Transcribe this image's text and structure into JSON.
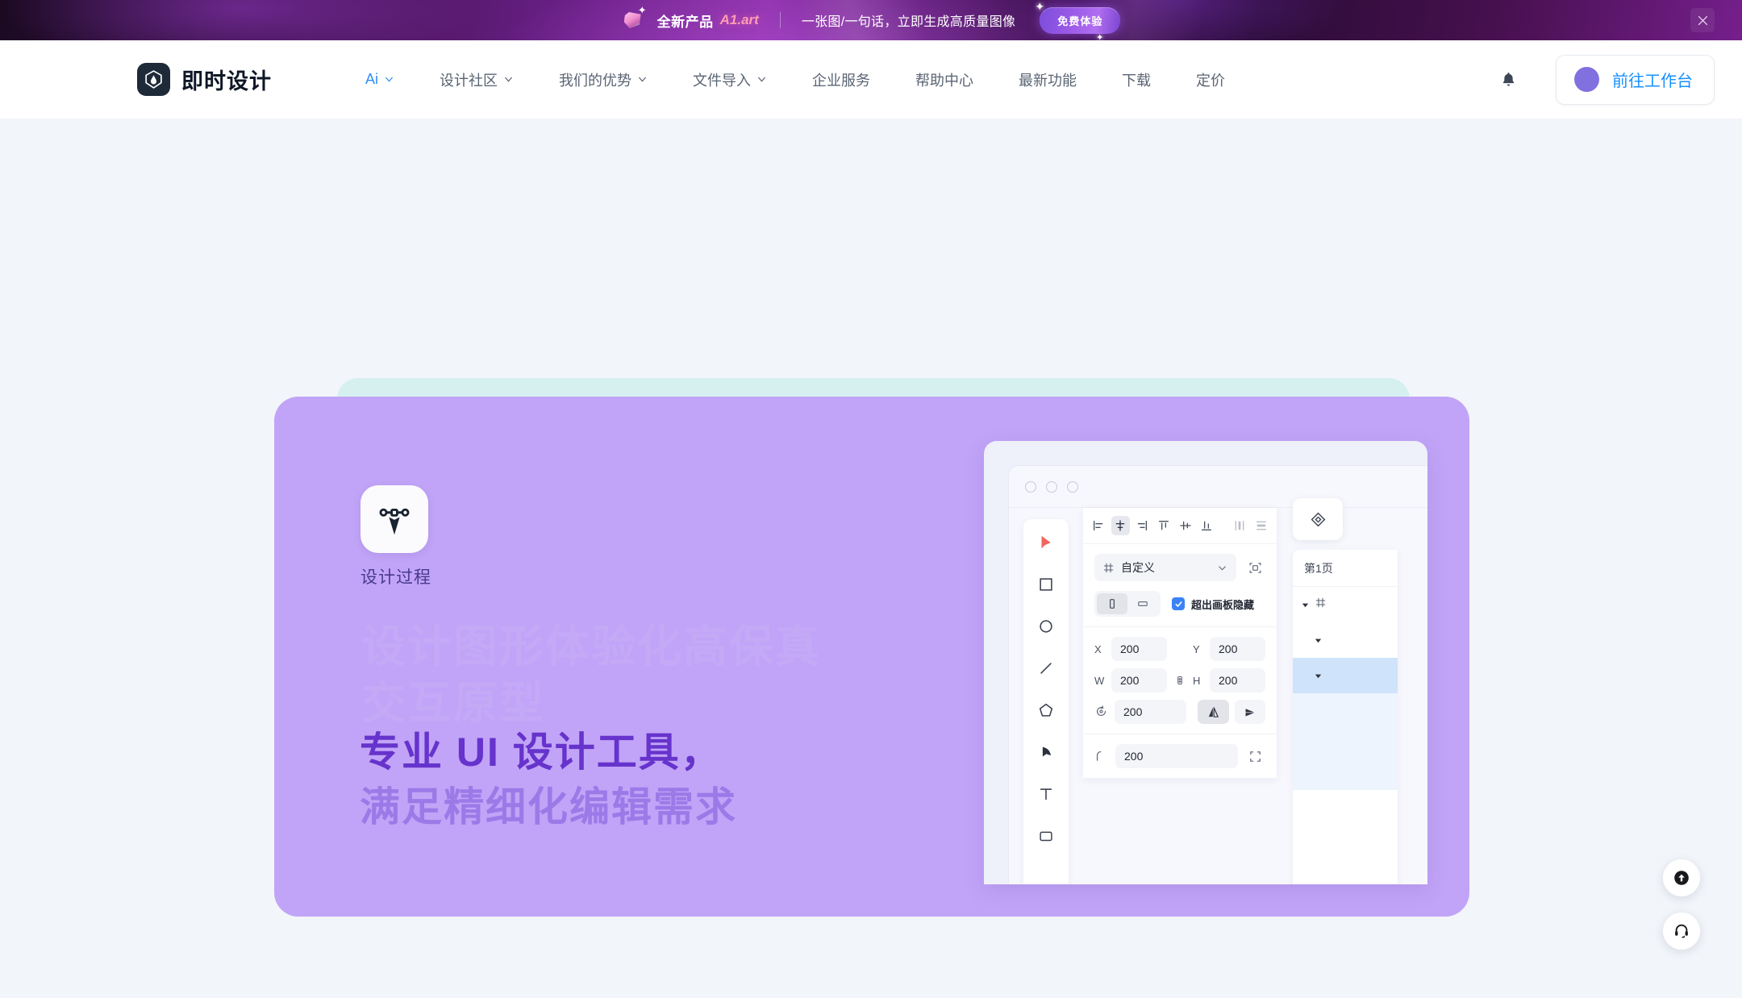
{
  "promo": {
    "gem_icon": "gem-icon",
    "title": "全新产品",
    "brand": "A1.art",
    "subtitle": "一张图/一句话，立即生成高质量图像",
    "cta": "免费体验",
    "close_icon": "close-icon"
  },
  "nav": {
    "logo_icon": "jishi-logo-icon",
    "logo_text": "即时设计",
    "items": [
      {
        "label": "Ai",
        "has_chevron": true,
        "active": true
      },
      {
        "label": "设计社区",
        "has_chevron": true,
        "active": false
      },
      {
        "label": "我们的优势",
        "has_chevron": true,
        "active": false
      },
      {
        "label": "文件导入",
        "has_chevron": true,
        "active": false
      },
      {
        "label": "企业服务",
        "has_chevron": false,
        "active": false
      },
      {
        "label": "帮助中心",
        "has_chevron": false,
        "active": false
      },
      {
        "label": "最新功能",
        "has_chevron": false,
        "active": false
      },
      {
        "label": "下载",
        "has_chevron": false,
        "active": false
      },
      {
        "label": "定价",
        "has_chevron": false,
        "active": false
      }
    ],
    "bell_icon": "bell-icon",
    "workspace_label": "前往工作台",
    "workspace_color": "#1890ff"
  },
  "hero": {
    "badge_icon": "vector-anchor-icon",
    "badge_label": "设计过程",
    "ghost_text": "设计图形体验化高保真交互原型",
    "headline_line1": "专业 UI 设计工具，",
    "headline_line2": "满足精细化编辑需求",
    "headline_color1": "#6633cc",
    "headline_color2": "#9b7ae8",
    "card_color": "#c1a4f7",
    "card_back_color": "#d6f0f0"
  },
  "mockup": {
    "window_dots": 3,
    "tools": [
      {
        "name": "cursor-tool",
        "icon": "cursor-icon"
      },
      {
        "name": "rectangle-tool",
        "icon": "square-icon"
      },
      {
        "name": "ellipse-tool",
        "icon": "circle-icon"
      },
      {
        "name": "line-tool",
        "icon": "line-icon"
      },
      {
        "name": "polygon-tool",
        "icon": "pentagon-icon"
      },
      {
        "name": "pen-tool",
        "icon": "pen-icon"
      },
      {
        "name": "text-tool",
        "icon": "text-T-icon"
      },
      {
        "name": "frame-tool",
        "icon": "frame-icon"
      }
    ],
    "align_buttons": [
      {
        "name": "align-left",
        "active": false
      },
      {
        "name": "align-horizontal-center",
        "active": true
      },
      {
        "name": "align-right",
        "active": false
      },
      {
        "name": "align-top",
        "active": false
      },
      {
        "name": "align-vertical-center",
        "active": false
      },
      {
        "name": "align-bottom",
        "active": false
      },
      {
        "name": "distribute-horizontal",
        "active": false
      },
      {
        "name": "distribute-vertical",
        "active": false
      }
    ],
    "preset_label": "自定义",
    "preset_icon": "frame-icon",
    "resize_icon": "fit-content-icon",
    "orientation": {
      "portrait_active": true,
      "landscape_active": false
    },
    "clip_checkbox": {
      "label": "超出画板隐藏",
      "checked": true,
      "color": "#3b82f6"
    },
    "fields": {
      "x_label": "X",
      "x_value": "200",
      "y_label": "Y",
      "y_value": "200",
      "w_label": "W",
      "w_value": "200",
      "h_label": "H",
      "h_value": "200",
      "rotation_value": "200",
      "radius_value": "200"
    },
    "flip_horizontal": {
      "name": "flip-horizontal",
      "active": true
    },
    "flip_vertical": {
      "name": "flip-vertical",
      "active": false
    },
    "right_tool_icon": "component-diamond-icon",
    "layers": {
      "page_label": "第1页",
      "rows": [
        {
          "indent": 0,
          "selected": false,
          "has_frame_icon": true
        },
        {
          "indent": 1,
          "selected": false,
          "has_frame_icon": false
        },
        {
          "indent": 1,
          "selected": true,
          "has_frame_icon": false
        }
      ]
    }
  },
  "fabs": [
    {
      "name": "back-to-top-button",
      "icon": "arrow-up-circle-icon"
    },
    {
      "name": "support-button",
      "icon": "headset-icon"
    }
  ]
}
